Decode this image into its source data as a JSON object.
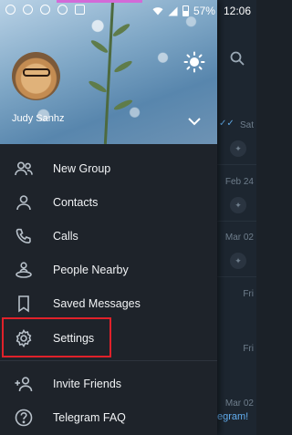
{
  "status_bar": {
    "battery": "57%",
    "time": "12:06"
  },
  "header": {
    "user_name": "Judy Sanhz"
  },
  "menu": {
    "items": [
      {
        "label": "New Group",
        "icon": "new-group-icon"
      },
      {
        "label": "Contacts",
        "icon": "contacts-icon"
      },
      {
        "label": "Calls",
        "icon": "phone-icon"
      },
      {
        "label": "People Nearby",
        "icon": "people-nearby-icon"
      },
      {
        "label": "Saved Messages",
        "icon": "bookmark-icon"
      },
      {
        "label": "Settings",
        "icon": "gear-icon"
      }
    ],
    "secondary": [
      {
        "label": "Invite Friends",
        "icon": "add-user-icon"
      },
      {
        "label": "Telegram FAQ",
        "icon": "question-icon"
      }
    ]
  },
  "background_chats": {
    "dates": [
      "Sat",
      "Feb 24",
      "Mar 02",
      "Fri",
      "Fri",
      "Mar 02"
    ],
    "link_text": "egram!"
  },
  "colors": {
    "drawer_bg": "#1e232a",
    "highlight_border": "#e0212a",
    "link": "#62aef0"
  }
}
